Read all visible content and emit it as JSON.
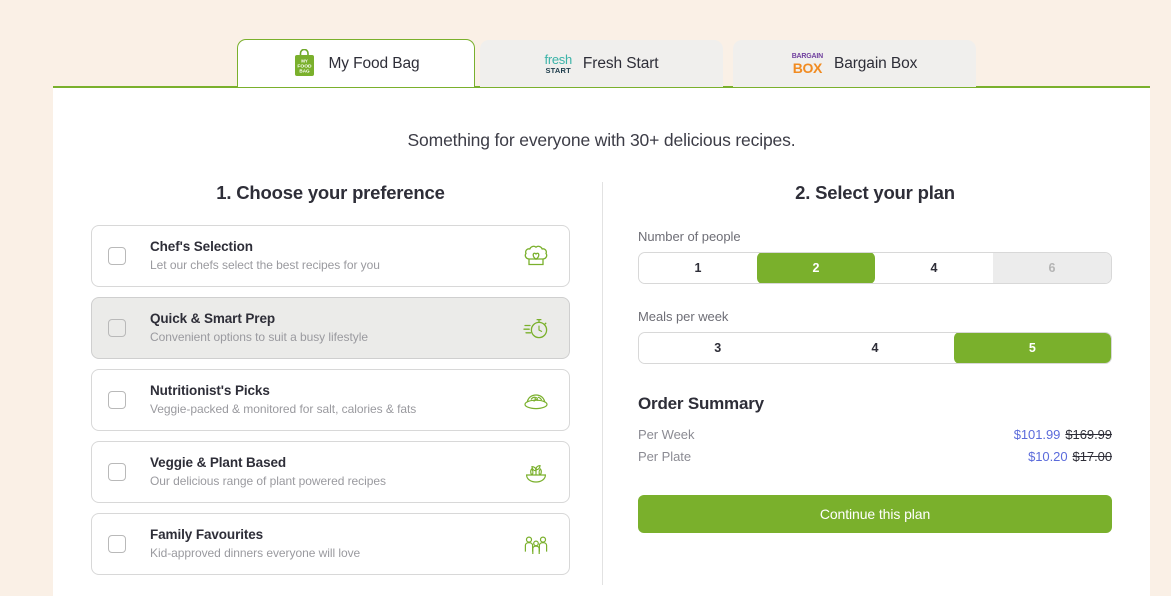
{
  "theme": {
    "brand_green": "#7ab02c",
    "page_background": "#faf0e6",
    "panel_background": "#ffffff",
    "price_now_color": "#5b6bdb",
    "hover_card_background": "#ebebe9"
  },
  "tabs": [
    {
      "label": "My Food Bag",
      "active": true,
      "logo": "my-food-bag-logo",
      "logo_line1": "MY",
      "logo_line2": "FOOD",
      "logo_line3": "BAG"
    },
    {
      "label": "Fresh Start",
      "active": false,
      "logo": "fresh-start-logo",
      "logo_line1": "fresh",
      "logo_line2": "START"
    },
    {
      "label": "Bargain Box",
      "active": false,
      "logo": "bargain-box-logo",
      "logo_line1": "BARGAIN",
      "logo_line2": "BOX"
    }
  ],
  "headline": "Something for everyone with 30+ delicious recipes.",
  "left": {
    "title": "1. Choose your preference",
    "preferences": [
      {
        "title": "Chef's Selection",
        "subtitle": "Let our chefs select the best recipes for you",
        "icon": "chef-hat-heart-icon",
        "checked": false,
        "hovered": false
      },
      {
        "title": "Quick & Smart Prep",
        "subtitle": "Convenient options to suit a busy lifestyle",
        "icon": "fast-stopwatch-icon",
        "checked": false,
        "hovered": true
      },
      {
        "title": "Nutritionist's Picks",
        "subtitle": "Veggie-packed & monitored for salt, calories & fats",
        "icon": "salad-plate-icon",
        "checked": false,
        "hovered": false
      },
      {
        "title": "Veggie & Plant Based",
        "subtitle": "Our delicious range of plant powered recipes",
        "icon": "plant-bowl-icon",
        "checked": false,
        "hovered": false
      },
      {
        "title": "Family Favourites",
        "subtitle": "Kid-approved dinners everyone will love",
        "icon": "family-group-icon",
        "checked": false,
        "hovered": false
      }
    ]
  },
  "right": {
    "title": "2. Select your plan",
    "people": {
      "label": "Number of people",
      "options": [
        {
          "value": "1",
          "selected": false,
          "disabled": false
        },
        {
          "value": "2",
          "selected": true,
          "disabled": false
        },
        {
          "value": "4",
          "selected": false,
          "disabled": false
        },
        {
          "value": "6",
          "selected": false,
          "disabled": true
        }
      ]
    },
    "meals": {
      "label": "Meals per week",
      "options": [
        {
          "value": "3",
          "selected": false,
          "disabled": false
        },
        {
          "value": "4",
          "selected": false,
          "disabled": false
        },
        {
          "value": "5",
          "selected": true,
          "disabled": false
        }
      ]
    },
    "summary": {
      "title": "Order Summary",
      "rows": [
        {
          "label": "Per Week",
          "price_now": "$101.99",
          "price_was": "$169.99"
        },
        {
          "label": "Per Plate",
          "price_now": "$10.20",
          "price_was": "$17.00"
        }
      ]
    },
    "cta_label": "Continue this plan"
  }
}
